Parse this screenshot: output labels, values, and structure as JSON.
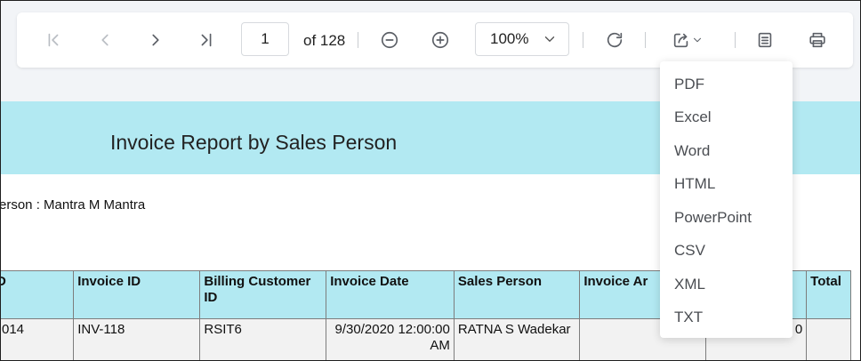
{
  "toolbar": {
    "page_value": "1",
    "page_total_label": "of 128",
    "zoom_value": "100%"
  },
  "icons": {
    "first_page": "first-page-icon",
    "prev_page": "prev-page-icon",
    "next_page": "next-page-icon",
    "last_page": "last-page-icon",
    "zoom_out": "zoom-out-icon",
    "zoom_in": "zoom-in-icon",
    "refresh": "refresh-icon",
    "export": "export-icon",
    "parameters": "parameters-icon",
    "print": "print-icon"
  },
  "export_menu": {
    "items": [
      "PDF",
      "Excel",
      "Word",
      "HTML",
      "PowerPoint",
      "CSV",
      "XML",
      "TXT"
    ]
  },
  "report": {
    "title": "Invoice Report by Sales Person",
    "sales_person_line": "erson : Mantra M Mantra",
    "table": {
      "headers": [
        "D",
        "Invoice ID",
        "Billing Customer ID",
        "Invoice Date",
        "Sales Person",
        "Invoice Ar",
        "",
        "Total"
      ],
      "rows": [
        [
          "014",
          "INV-118",
          "RSIT6",
          "9/30/2020 12:00:00 AM",
          "RATNA S Wadekar",
          "",
          "0",
          ""
        ]
      ]
    }
  },
  "colors": {
    "banner": "#b2e9f2",
    "header_cell": "#b2e9f2",
    "row_bg": "#f2f2f2",
    "page_bg": "#f2f4f7"
  }
}
